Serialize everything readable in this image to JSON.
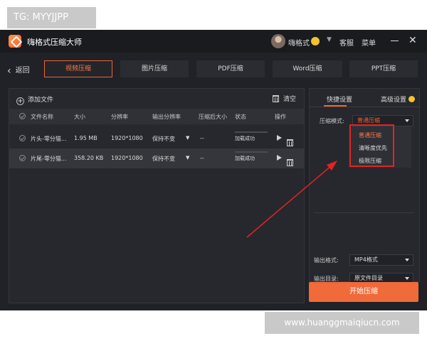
{
  "watermark_top": "TG: MYYJJPP",
  "watermark_bottom": "www.huanggmaiqiucn.com",
  "window": {
    "title": "嗨格式压缩大师",
    "username": "嗨格式",
    "service": "客服",
    "menu": "菜单"
  },
  "nav": {
    "back": "返回",
    "tabs": [
      "视频压缩",
      "图片压缩",
      "PDF压缩",
      "Word压缩",
      "PPT压缩"
    ],
    "active_tab": 0
  },
  "file_panel": {
    "add_file": "添加文件",
    "clear": "清空",
    "columns": [
      "文件名称",
      "大小",
      "分辨率",
      "输出分辨率",
      "压缩后大小",
      "状态",
      "操作"
    ],
    "rows": [
      {
        "name": "片头-零分猫...",
        "size": "1.95 MB",
        "resolution": "1920*1080",
        "output_resolution": "保持不变",
        "compressed_size": "--",
        "status": "加载成功"
      },
      {
        "name": "片尾-零分猫...",
        "size": "358.20 KB",
        "resolution": "1920*1080",
        "output_resolution": "保持不变",
        "compressed_size": "--",
        "status": "加载成功"
      }
    ]
  },
  "settings_panel": {
    "tabs": [
      "快捷设置",
      "高级设置"
    ],
    "compress_mode_label": "压缩模式:",
    "compress_mode_value": "普通压缩",
    "compress_mode_options": [
      "普通压缩",
      "清晰度优先",
      "极限压缩"
    ],
    "output_format_label": "输出格式:",
    "output_format_value": "MP4格式",
    "output_dir_label": "输出目录:",
    "output_dir_value": "原文件目录"
  },
  "start_button": "开始压缩",
  "colors": {
    "accent": "#f06a3a",
    "annotation": "#e02424",
    "background": "#202227"
  }
}
